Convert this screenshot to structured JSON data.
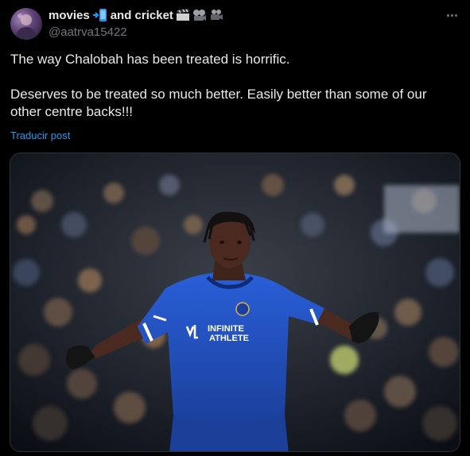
{
  "post": {
    "author_name": "movies",
    "author_name_suffix": "and cricket",
    "handle": "@aatrva15422",
    "paragraphs": [
      "The way Chalobah has been treated is horrific.",
      "Deserves to be treated so much better. Easily better than some of our other centre backs!!!"
    ],
    "translate_label": "Traducir post",
    "more_icon": "more-horizontal-icon",
    "name_emojis": [
      "mobile-arrow-emoji",
      "clapper-board-emoji",
      "projector-emoji",
      "movie-camera-emoji"
    ]
  },
  "media": {
    "shirt_sponsor_line1": "INFINITE",
    "shirt_sponsor_line2": "ATHLETE",
    "description_icon": "football-player-photo"
  },
  "colors": {
    "background": "#000000",
    "text": "#e7e9ea",
    "secondary": "#71767b",
    "link": "#1d9bf0",
    "kit_blue": "#1f4fc4"
  }
}
